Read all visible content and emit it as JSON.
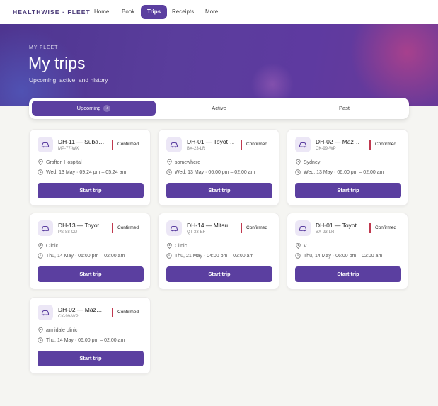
{
  "brand": "HEALTHWISE · FLEET",
  "nav": [
    {
      "label": "Home",
      "active": false
    },
    {
      "label": "Book",
      "active": false
    },
    {
      "label": "Trips",
      "active": true
    },
    {
      "label": "Receipts",
      "active": false
    },
    {
      "label": "More",
      "active": false
    }
  ],
  "hero": {
    "eyebrow": "MY FLEET",
    "title": "My trips",
    "subtitle": "Upcoming, active, and history"
  },
  "tabs": [
    {
      "label": "Upcoming",
      "count": "7",
      "active": true
    },
    {
      "label": "Active",
      "count": "",
      "active": false
    },
    {
      "label": "Past",
      "count": "",
      "active": false
    }
  ],
  "trips": [
    {
      "title": "DH-11 — Subaru ...",
      "plate": "MP-77-WX",
      "status": "Confirmed",
      "location": "Grafton Hospital",
      "time": "Wed, 13 May · 09:24 pm – 05:24 am",
      "action": "Start trip"
    },
    {
      "title": "DH-01 — Toyota ...",
      "plate": "BX-23-LR",
      "status": "Confirmed",
      "location": "somewhere",
      "time": "Wed, 13 May · 06:00 pm – 02:00 am",
      "action": "Start trip"
    },
    {
      "title": "DH-02 — Mazda ...",
      "plate": "CK-99-WP",
      "status": "Confirmed",
      "location": "Sydney",
      "time": "Wed, 13 May · 06:00 pm – 02:00 am",
      "action": "Start trip"
    },
    {
      "title": "DH-13 — Toyota ...",
      "plate": "PS-88-CD",
      "status": "Confirmed",
      "location": "Clinic",
      "time": "Thu, 14 May · 06:00 pm – 02:00 am",
      "action": "Start trip"
    },
    {
      "title": "DH-14 — Mitsubi...",
      "plate": "QT-33-EF",
      "status": "Confirmed",
      "location": "Clinic",
      "time": "Thu, 21 May · 04:00 pm – 02:00 am",
      "action": "Start trip"
    },
    {
      "title": "DH-01 — Toyota ...",
      "plate": "BX-23-LR",
      "status": "Confirmed",
      "location": "V",
      "time": "Thu, 14 May · 06:00 pm – 02:00 am",
      "action": "Start trip"
    },
    {
      "title": "DH-02 — Mazda ...",
      "plate": "CK-99-WP",
      "status": "Confirmed",
      "location": "armidale clinic",
      "time": "Thu, 14 May · 06:00 pm – 02:00 am",
      "action": "Start trip"
    }
  ],
  "icons": {
    "vehicle": "car-icon",
    "location": "map-pin-icon",
    "time": "clock-icon"
  },
  "colors": {
    "accent": "#5b3fa0",
    "status_confirmed": "#c0394f",
    "icon_bg": "#ece7f6"
  }
}
